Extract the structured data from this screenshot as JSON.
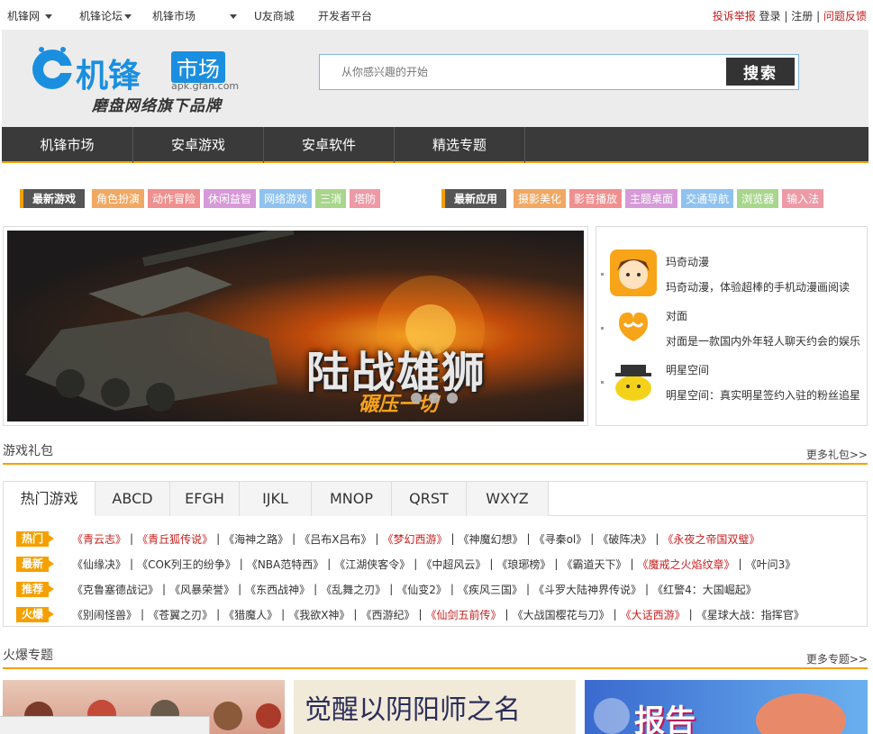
{
  "topbar": {
    "links": [
      "机锋网",
      "机锋论坛",
      "机锋市场",
      "U友商城",
      "开发者平台"
    ],
    "report": "投诉举报",
    "login": "登录",
    "sep": "|",
    "register": "注册",
    "feedback": "问题反馈"
  },
  "header": {
    "logo_text": "机锋",
    "logo_badge": "市场",
    "logo_domain": "apk.gfan.com",
    "slogan": "磨盘网络旗下品牌",
    "search_placeholder": "从你感兴趣的开始",
    "search_button": "搜索"
  },
  "nav": [
    "机锋市场",
    "安卓游戏",
    "安卓软件",
    "精选专题"
  ],
  "tags": {
    "games_label": "最新游戏",
    "games": [
      {
        "text": "角色扮演",
        "color": "#f0a863"
      },
      {
        "text": "动作冒险",
        "color": "#f08f8f"
      },
      {
        "text": "休闲益智",
        "color": "#d69ad8"
      },
      {
        "text": "网络游戏",
        "color": "#8fc2ef"
      },
      {
        "text": "三消",
        "color": "#a8d68c"
      },
      {
        "text": "塔防",
        "color": "#ee9aa6"
      }
    ],
    "apps_label": "最新应用",
    "apps": [
      {
        "text": "摄影美化",
        "color": "#f0a863"
      },
      {
        "text": "影音播放",
        "color": "#f08f8f"
      },
      {
        "text": "主题桌面",
        "color": "#d69ad8"
      },
      {
        "text": "交通导航",
        "color": "#8fc2ef"
      },
      {
        "text": "浏览器",
        "color": "#a8d68c"
      },
      {
        "text": "输入法",
        "color": "#ee9aa6"
      }
    ]
  },
  "banner": {
    "title": "陆战雄狮",
    "subtitle": "碾压一切"
  },
  "apps": [
    {
      "name": "玛奇动漫",
      "desc": "玛奇动漫，体验超棒的手机动漫画阅读"
    },
    {
      "name": "对面",
      "desc": "对面是一款国内外年轻人聊天约会的娱乐"
    },
    {
      "name": "明星空间",
      "desc": "明星空间：真实明星签约入驻的粉丝追星"
    }
  ],
  "gifts": {
    "title": "游戏礼包",
    "more": "更多礼包>>",
    "tabs": [
      "热门游戏",
      "ABCD",
      "EFGH",
      "IJKL",
      "MNOP",
      "QRST",
      "WXYZ"
    ],
    "rows": [
      {
        "label": "热门",
        "games": [
          {
            "t": "《青云志》",
            "red": true
          },
          {
            "t": "《青丘狐传说》",
            "red": true
          },
          {
            "t": "《海神之路》",
            "red": false
          },
          {
            "t": "《吕布X吕布》",
            "red": false
          },
          {
            "t": "《梦幻西游》",
            "red": true
          },
          {
            "t": "《神魔幻想》",
            "red": false
          },
          {
            "t": "《寻秦ol》",
            "red": false
          },
          {
            "t": "《破阵决》",
            "red": false
          },
          {
            "t": "《永夜之帝国双璧》",
            "red": true
          }
        ]
      },
      {
        "label": "最新",
        "games": [
          {
            "t": "《仙缘决》",
            "red": false
          },
          {
            "t": "《COK列王的纷争》",
            "red": false
          },
          {
            "t": "《NBA范特西》",
            "red": false
          },
          {
            "t": "《江湖侠客令》",
            "red": false
          },
          {
            "t": "《中超风云》",
            "red": false
          },
          {
            "t": "《琅琊榜》",
            "red": false
          },
          {
            "t": "《霸道天下》",
            "red": false
          },
          {
            "t": "《魔戒之火焰纹章》",
            "red": true
          },
          {
            "t": "《叶问3》",
            "red": false
          }
        ]
      },
      {
        "label": "推荐",
        "games": [
          {
            "t": "《克鲁塞德战记》",
            "red": false
          },
          {
            "t": "《风暴荣誉》",
            "red": false
          },
          {
            "t": "《东西战神》",
            "red": false
          },
          {
            "t": "《乱舞之刃》",
            "red": false
          },
          {
            "t": "《仙变2》",
            "red": false
          },
          {
            "t": "《疾风三国》",
            "red": false
          },
          {
            "t": "《斗罗大陆神界传说》",
            "red": false
          },
          {
            "t": "《红警4：大国崛起》",
            "red": false
          }
        ]
      },
      {
        "label": "火爆",
        "games": [
          {
            "t": "《别闹怪兽》",
            "red": false
          },
          {
            "t": "《苍翼之刃》",
            "red": false
          },
          {
            "t": "《猎魔人》",
            "red": false
          },
          {
            "t": "《我欲X神》",
            "red": false
          },
          {
            "t": "《西游纪》",
            "red": false
          },
          {
            "t": "《仙剑五前传》",
            "red": true
          },
          {
            "t": "《大战国樱花与刀》",
            "red": false
          },
          {
            "t": "《大话西游》",
            "red": true
          },
          {
            "t": "《星球大战：指挥官》",
            "red": false
          }
        ]
      }
    ]
  },
  "topics": {
    "title": "火爆专题",
    "more": "更多专题>>",
    "items": [
      "觉醒以阴阳师之名",
      "报告"
    ]
  },
  "colors": {
    "accent": "#f5a000",
    "nav_bg": "#3a3a3a",
    "link_red": "#c81e1e"
  }
}
